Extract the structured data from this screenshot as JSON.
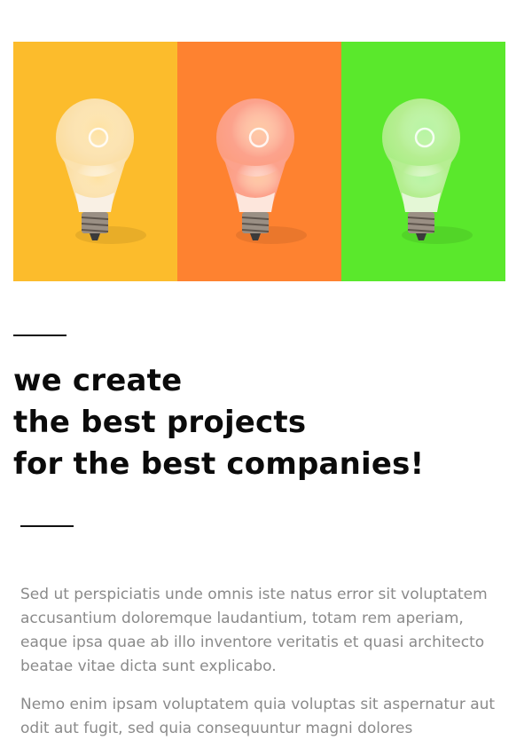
{
  "hero": {
    "panels": [
      {
        "name": "yellow-bulb-panel",
        "background": "#fcbc2c",
        "bulb": "#fbe2b0",
        "base": "#f9f0e4"
      },
      {
        "name": "orange-bulb-panel",
        "background": "#fe8230",
        "bulb": "#fca28c",
        "base": "#fde6dc"
      },
      {
        "name": "green-bulb-panel",
        "background": "#5ae82c",
        "bulb": "#b6ee92",
        "base": "#e4f7d6"
      }
    ]
  },
  "headline": {
    "line1": "we create",
    "line2": "the best projects",
    "line3": "for the best companies!"
  },
  "body": {
    "paragraph1": "Sed ut perspiciatis unde omnis iste natus error sit voluptatem accusantium doloremque laudantium, totam rem aperiam, eaque ipsa quae ab illo inventore veritatis et quasi architecto beatae vitae dicta sunt explicabo.",
    "paragraph2": "Nemo enim ipsam voluptatem quia voluptas sit aspernatur aut odit aut fugit, sed quia consequuntur magni dolores"
  }
}
